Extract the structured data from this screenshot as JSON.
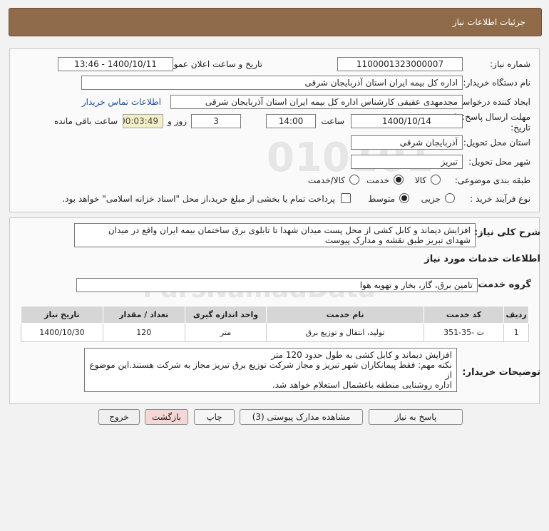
{
  "header": {
    "title": "جزئیات اطلاعات نیاز"
  },
  "need": {
    "number_label": "شماره نیاز:",
    "number": "1100001323000007",
    "announce_label": "تاریخ و ساعت اعلان عمومی:",
    "announce_value": "1400/10/11 - 13:46",
    "buyer_label": "نام دستگاه خریدار:",
    "buyer": "اداره کل بیمه ایران استان آذربایجان شرقی",
    "creator_label": "ایجاد کننده درخواست:",
    "creator": "مجدمهدی عقیقی کارشناس اداره کل بیمه ایران استان آذربایجان شرقی",
    "contact_link": "اطلاعات تماس خریدار",
    "deadline_label_1": "مهلت ارسال پاسخ: تا",
    "deadline_label_2": "تاریخ:",
    "deadline_date": "1400/10/14",
    "time_label": "ساعت",
    "deadline_time": "14:00",
    "days": "3",
    "days_label": "روز و",
    "remaining_time": "00:03:49",
    "remaining_label": "ساعت باقی مانده",
    "province_label": "استان محل تحویل:",
    "province": "آذربایجان شرقی",
    "city_label": "شهر محل تحویل:",
    "city": "تبریز",
    "category_label": "طبقه بندی موضوعی:",
    "category_options": [
      "کالا",
      "خدمت",
      "کالا/خدمت"
    ],
    "category_selected": 1,
    "process_label": "نوع فرآیند خرید :",
    "process_options": [
      "جزیی",
      "متوسط"
    ],
    "process_selected": 1,
    "payment_note": "پرداخت تمام یا بخشی از مبلغ خرید،از محل \"اسناد خزانه اسلامی\" خواهد بود."
  },
  "summary": {
    "label": "شرح کلی نیاز:",
    "text_line1": "افزایش دیماند و کابل کشی از محل پست میدان شهدا تا تابلوی برق ساختمان بیمه ایران واقع در میدان",
    "text_line2": "شهدای تبریز طبق نقشه و مدارک پیوست"
  },
  "services": {
    "section_title": "اطلاعات خدمات مورد نیاز",
    "group_label": "گروه خدمت:",
    "group_value": "تامین برق، گاز، بخار و تهویه هوا",
    "columns": [
      "ردیف",
      "کد خدمت",
      "نام خدمت",
      "واحد اندازه گیری",
      "تعداد / مقدار",
      "تاریخ نیاز"
    ],
    "rows": [
      [
        "1",
        "ت -35-351",
        "تولید، انتقال و توزیع برق",
        "متر",
        "120",
        "1400/10/30"
      ]
    ]
  },
  "buyer_notes": {
    "label": "توضیحات خریدار:",
    "line1": "افزایش دیماند و کابل کشی به طول حدود 120 متر",
    "line2": "نکته مهم: فقط پیمانکاران شهر تبریز و مجاز شرکت توزیع برق تبریز مجاز به شرکت هستند.این موضوع از",
    "line3": "اداره روشنایی منطقه باغشمال استعلام خواهد شد."
  },
  "buttons": {
    "reply": "پاسخ به نیاز",
    "attachments": "مشاهده مدارک پیوستی (3)",
    "print": "چاپ",
    "back": "بازگشت",
    "exit": "خروج"
  }
}
